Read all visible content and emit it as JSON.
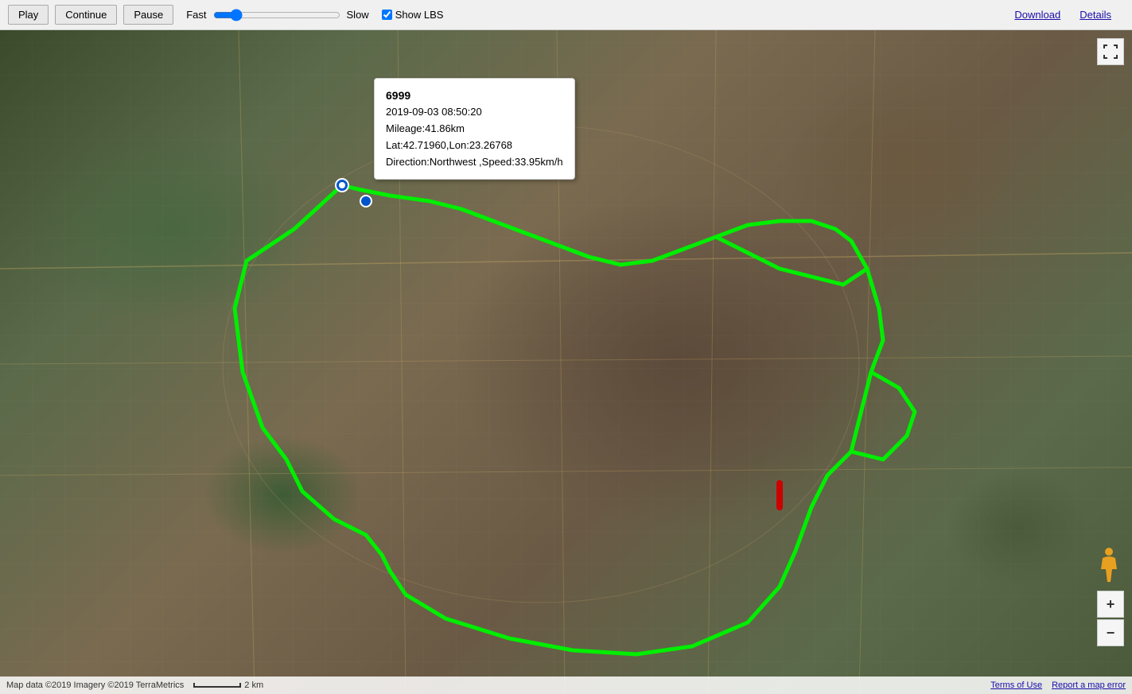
{
  "toolbar": {
    "play_label": "Play",
    "continue_label": "Continue",
    "pause_label": "Pause",
    "fast_label": "Fast",
    "slow_label": "Slow",
    "show_lbs_label": "Show LBS",
    "download_label": "Download",
    "details_label": "Details"
  },
  "popup": {
    "id": "6999",
    "datetime": "2019-09-03 08:50:20",
    "mileage": "Mileage:41.86km",
    "latlon": "Lat:42.71960,Lon:23.26768",
    "direction_speed": "Direction:Northwest ,Speed:33.95km/h"
  },
  "attribution": {
    "map_data": "Map data ©2019 Imagery ©2019 TerraMetrics",
    "scale": "2 km",
    "terms": "Terms of Use",
    "report": "Report a map error"
  },
  "icons": {
    "fullscreen": "⛶",
    "zoom_in": "+",
    "zoom_out": "−",
    "person": "🚶"
  }
}
